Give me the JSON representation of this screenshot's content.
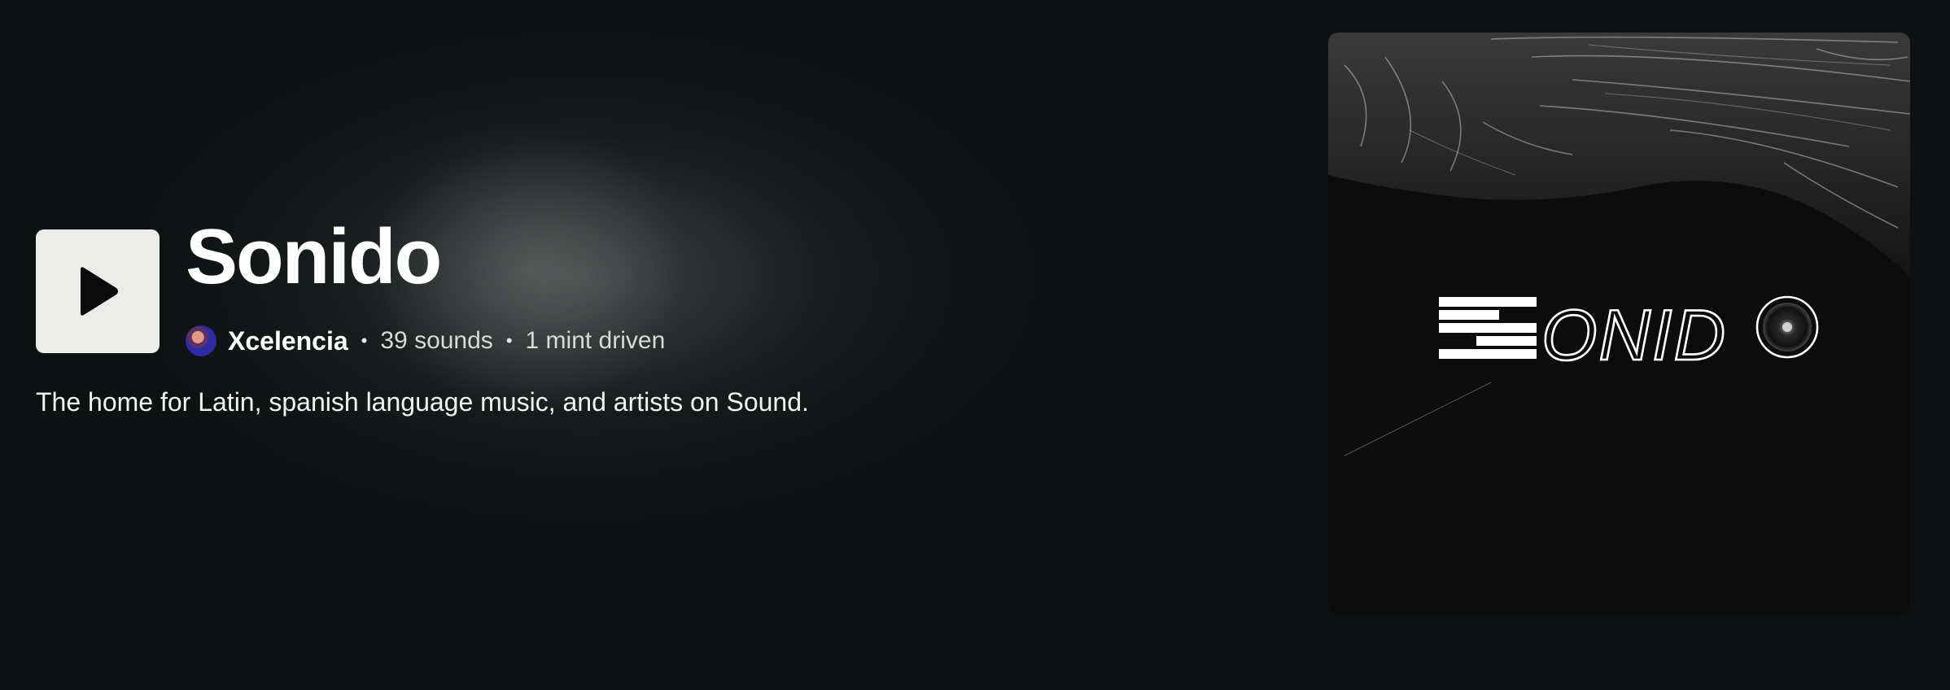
{
  "collection": {
    "title": "Sonido",
    "creator": "Xcelencia",
    "sounds_count": "39 sounds",
    "mint_info": "1 mint driven",
    "separator": "•",
    "description": "The home for Latin, spanish language music, and artists on Sound.",
    "cover_logo_text": "SONIDO"
  },
  "icons": {
    "play": "play-icon",
    "avatar": "creator-avatar"
  },
  "colors": {
    "background": "#0e1112",
    "play_button_bg": "#ececea",
    "title_text": "#ffffff"
  }
}
